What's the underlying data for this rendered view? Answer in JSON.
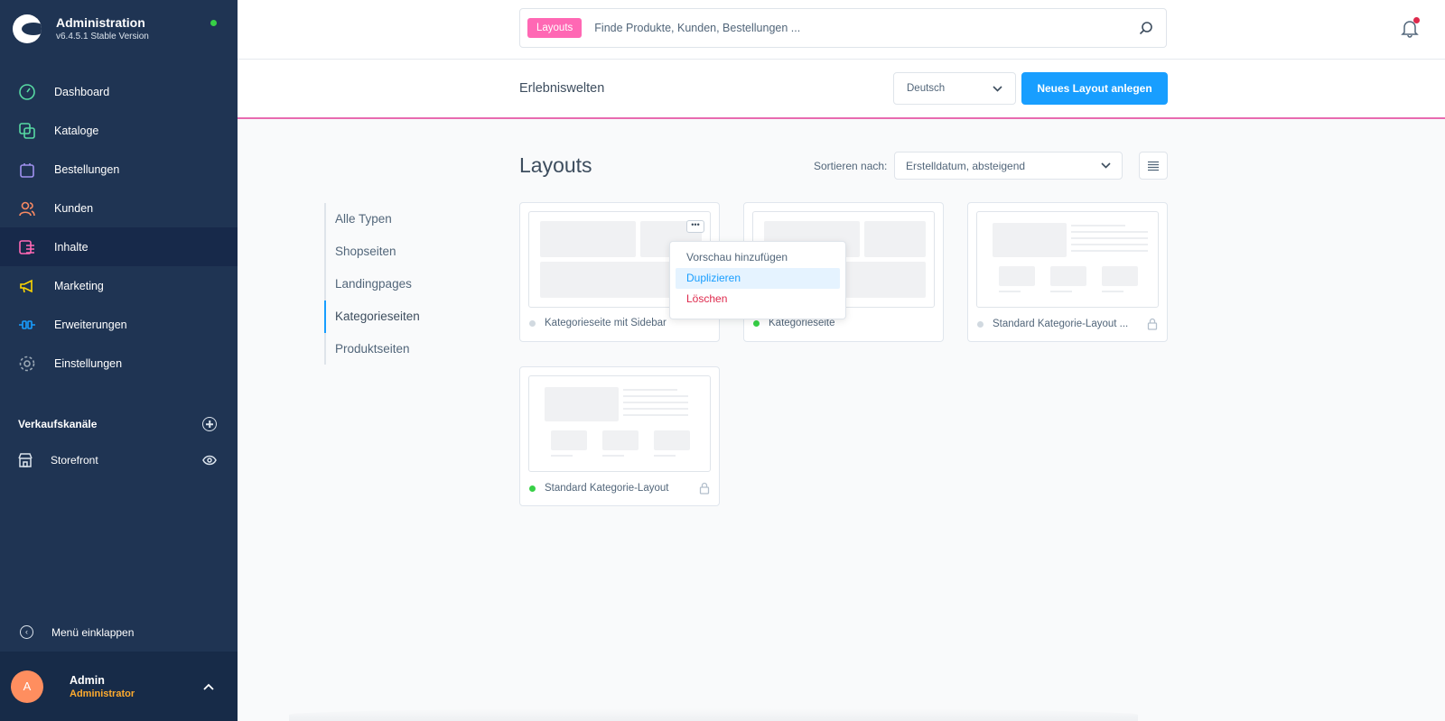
{
  "brand": {
    "title": "Administration",
    "version": "v6.4.5.1 Stable Version",
    "status_color": "#37d046"
  },
  "nav": {
    "items": [
      {
        "label": "Dashboard",
        "icon": "gauge-icon",
        "color": "#57d9a3"
      },
      {
        "label": "Kataloge",
        "icon": "products-icon",
        "color": "#57d9a3"
      },
      {
        "label": "Bestellungen",
        "icon": "shopping-bag-icon",
        "color": "#a092f0"
      },
      {
        "label": "Kunden",
        "icon": "users-icon",
        "color": "#f88962"
      },
      {
        "label": "Inhalte",
        "icon": "content-icon",
        "color": "#ff68b4"
      },
      {
        "label": "Marketing",
        "icon": "megaphone-icon",
        "color": "#ffd700"
      },
      {
        "label": "Erweiterungen",
        "icon": "plug-icon",
        "color": "#189eff"
      },
      {
        "label": "Einstellungen",
        "icon": "gear-icon",
        "color": "#9aa8b5"
      }
    ],
    "active_index": 4
  },
  "sales_channels": {
    "heading": "Verkaufskanäle",
    "items": [
      {
        "label": "Storefront"
      }
    ]
  },
  "collapse_label": "Menü einklappen",
  "user": {
    "initial": "A",
    "name": "Admin",
    "role": "Administrator"
  },
  "search": {
    "chip": "Layouts",
    "placeholder": "Finde Produkte, Kunden, Bestellungen ..."
  },
  "smartbar": {
    "title": "Erlebniswelten",
    "language": "Deutsch",
    "new_button": "Neues Layout anlegen"
  },
  "main": {
    "heading": "Layouts",
    "sort_label": "Sortieren nach:",
    "sort_value": "Erstelldatum, absteigend",
    "filters": [
      "Alle Typen",
      "Shopseiten",
      "Landingpages",
      "Kategorieseiten",
      "Produktseiten"
    ],
    "active_filter": 3,
    "cards": [
      {
        "name": "Kategorieseite mit Sidebar",
        "status_color": "#d1d9e0",
        "locked": false
      },
      {
        "name": "Kategorieseite",
        "status_color": "#37d046",
        "locked": false
      },
      {
        "name": "Standard Kategorie-Layout ...",
        "status_color": "#d1d9e0",
        "locked": true
      },
      {
        "name": "Standard Kategorie-Layout",
        "status_color": "#37d046",
        "locked": true
      }
    ],
    "context_menu": [
      "Vorschau hinzufügen",
      "Duplizieren",
      "Löschen"
    ]
  }
}
